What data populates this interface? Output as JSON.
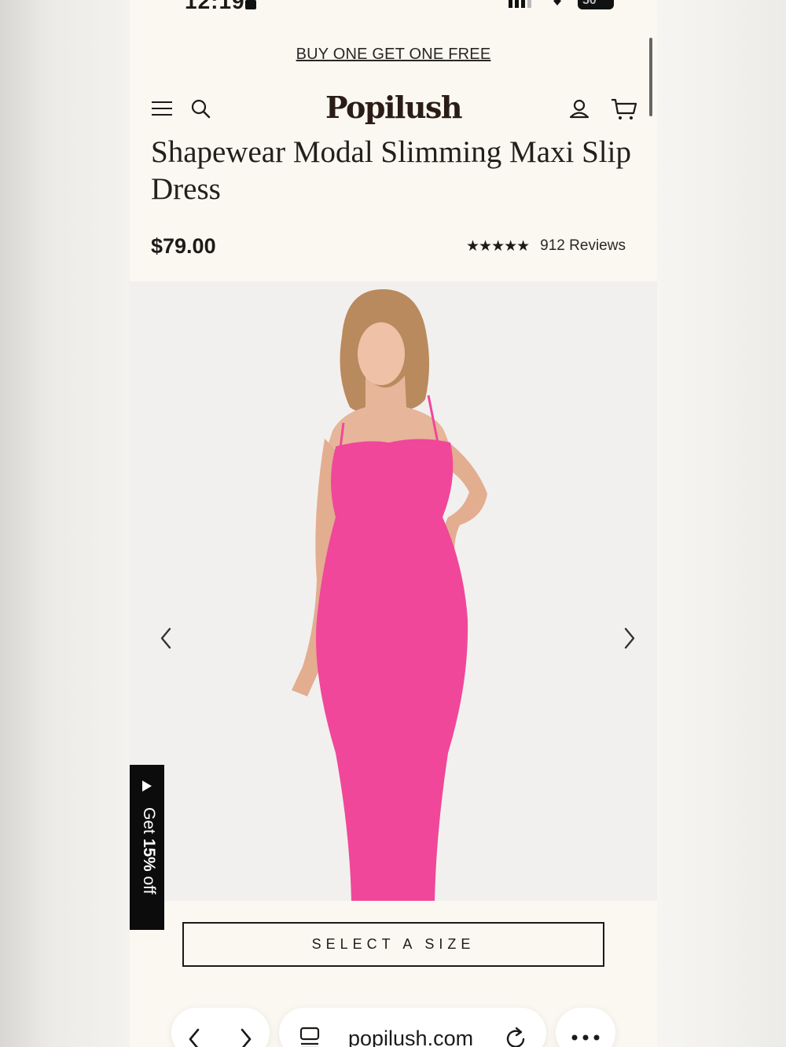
{
  "status_bar": {
    "time": "12:19",
    "battery": "50"
  },
  "promo": {
    "text": "BUY ONE GET ONE FREE"
  },
  "header": {
    "logo": "Popilush"
  },
  "product": {
    "title": "Shapewear Modal Slimming Maxi Slip Dress",
    "price": "$79.00",
    "stars": "★★★★★",
    "rating_value": 4.5,
    "reviews": "912 Reviews",
    "dress_color": "#f0479a"
  },
  "discount_tab": {
    "label_prefix": "Get ",
    "label_bold": "15%",
    "label_suffix": " off"
  },
  "cta": {
    "select_size": "SELECT A SIZE"
  },
  "browser": {
    "url": "popilush.com"
  },
  "icons": [
    "menu-icon",
    "search-icon",
    "account-icon",
    "cart-icon",
    "chevron-left-icon",
    "chevron-right-icon",
    "play-icon",
    "tabs-icon",
    "reload-icon",
    "more-icon"
  ]
}
